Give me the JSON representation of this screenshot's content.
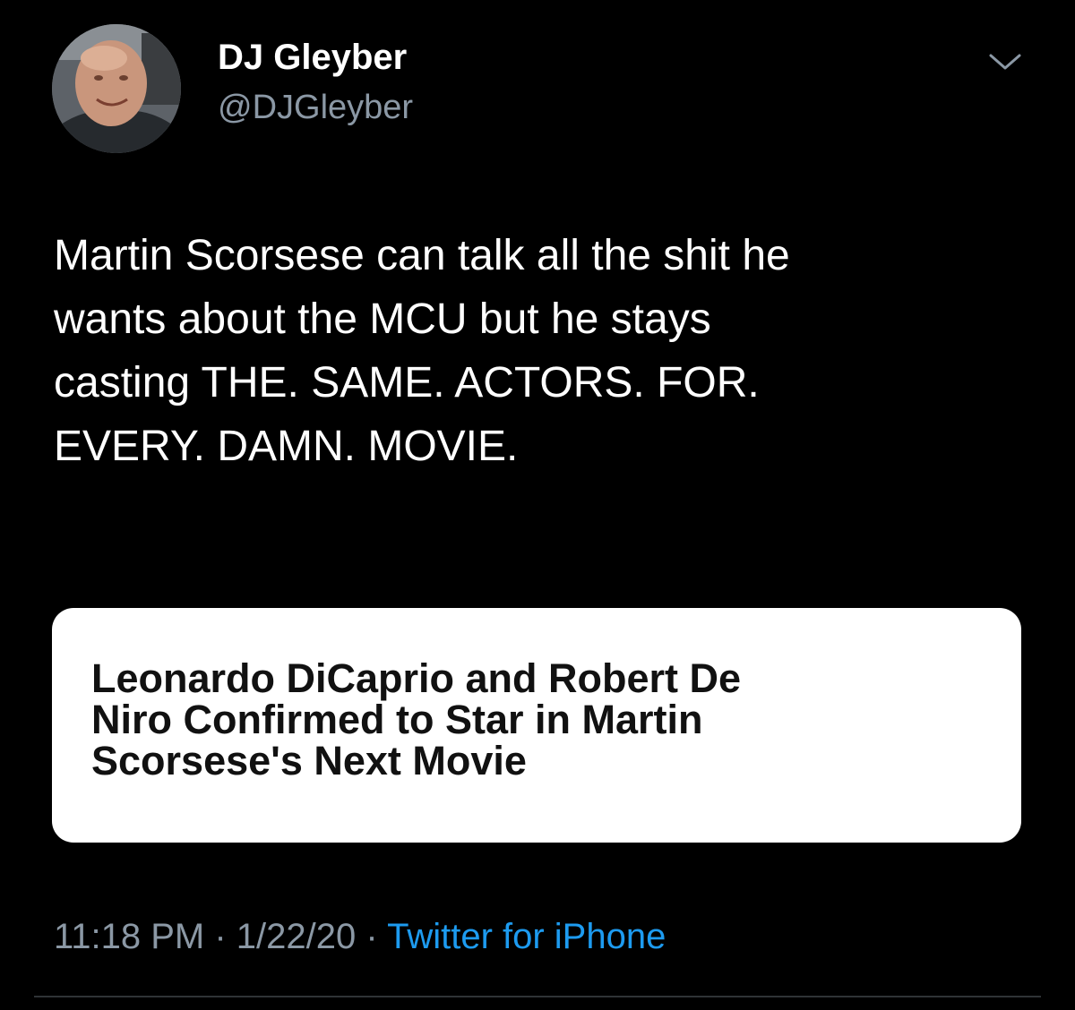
{
  "author": {
    "display_name": "DJ Gleyber",
    "handle": "@DJGleyber",
    "avatar_icon": "profile-photo"
  },
  "tweet": {
    "text_lines": [
      "Martin Scorsese can talk all the shit he",
      "wants about the MCU but he stays",
      "casting THE. SAME. ACTORS. FOR.",
      "EVERY. DAMN. MOVIE."
    ]
  },
  "card": {
    "headline_lines": [
      "Leonardo DiCaprio and Robert De",
      "Niro Confirmed to Star in Martin",
      "Scorsese's Next Movie"
    ]
  },
  "meta": {
    "time": "11:18 PM",
    "separator": " · ",
    "date": "1/22/20",
    "source": "Twitter for iPhone"
  },
  "colors": {
    "background": "#000000",
    "secondary_text": "#8b98a5",
    "link": "#1d9bf0",
    "card_background": "#ffffff"
  },
  "icons": {
    "menu": "chevron-down-icon"
  }
}
